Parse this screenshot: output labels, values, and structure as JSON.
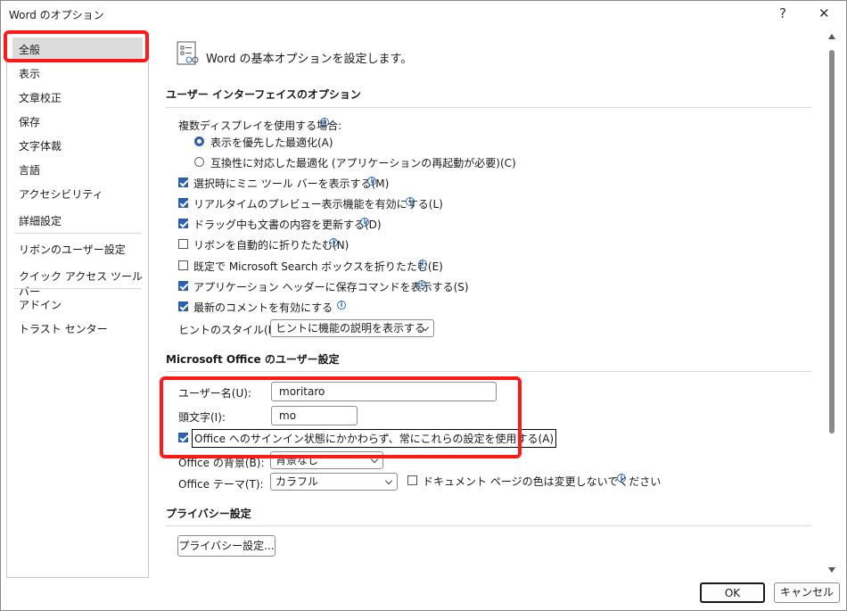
{
  "window": {
    "title": "Word のオプション",
    "help": "?",
    "close": "✕"
  },
  "nav": {
    "items": [
      "全般",
      "表示",
      "文章校正",
      "保存",
      "文字体裁",
      "言語",
      "アクセシビリティ",
      "詳細設定",
      "リボンのユーザー設定",
      "クイック アクセス ツール バー",
      "アドイン",
      "トラスト センター"
    ]
  },
  "header": {
    "text": "Word の基本オプションを設定します。"
  },
  "ui_section": {
    "title": "ユーザー インターフェイスのオプション",
    "multi_display_label": "複数ディスプレイを使用する場合:",
    "radio1": "表示を優先した最適化(A)",
    "radio2": "互換性に対応した最適化 (アプリケーションの再起動が必要)(C)",
    "cb_mini": "選択時にミニ ツール バーを表示する(M)",
    "cb_preview": "リアルタイムのプレビュー表示機能を有効にする(L)",
    "cb_drag": "ドラッグ中も文書の内容を更新する(D)",
    "cb_ribbon": "リボンを自動的に折りたたむ(N)",
    "cb_search": "既定で Microsoft Search ボックスを折りたたむ(E)",
    "cb_save": "アプリケーション ヘッダーに保存コマンドを表示する(S)",
    "cb_comments": "最新のコメントを有効にする",
    "tip_label": "ヒントのスタイル(R):",
    "tip_value": "ヒントに機能の説明を表示する"
  },
  "office_section": {
    "title": "Microsoft Office のユーザー設定",
    "username_label": "ユーザー名(U):",
    "username_value": "moritaro",
    "initials_label": "頭文字(I):",
    "initials_value": "mo",
    "always_label": "Office へのサインイン状態にかかわらず、常にこれらの設定を使用する(A)",
    "bg_label": "Office の背景(B):",
    "bg_value": "背景なし",
    "theme_label": "Office テーマ(T):",
    "theme_value": "カラフル",
    "page_color_label": "ドキュメント ページの色は変更しないでください"
  },
  "privacy_section": {
    "title": "プライバシー設定",
    "button": "プライバシー設定..."
  },
  "footer": {
    "ok": "OK",
    "cancel": "キャンセル"
  },
  "colors": {
    "accent": "#2d5fb0",
    "highlight": "#ff1a1a"
  }
}
